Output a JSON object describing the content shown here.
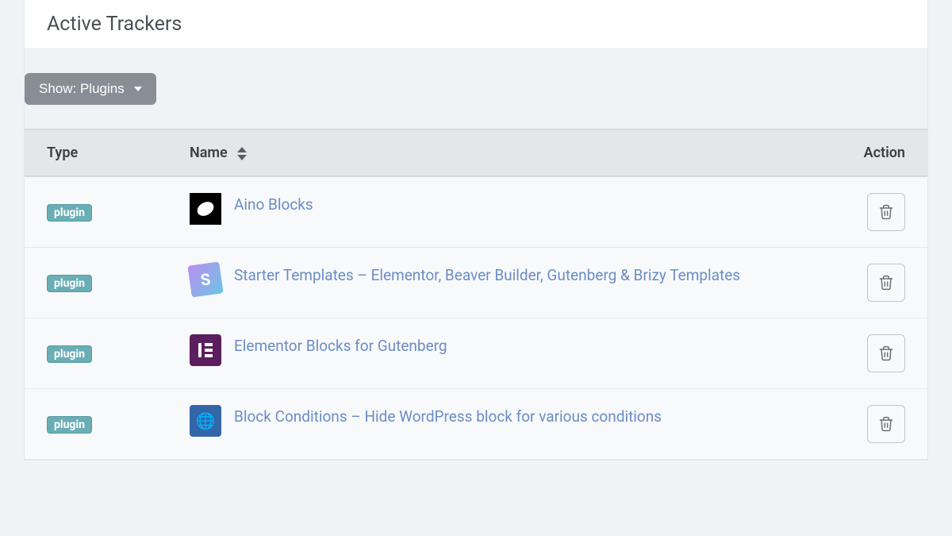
{
  "header": {
    "title": "Active Trackers"
  },
  "filter": {
    "label": "Show: Plugins"
  },
  "table": {
    "columns": {
      "type": "Type",
      "name": "Name",
      "action": "Action"
    },
    "rows": [
      {
        "type_badge": "plugin",
        "name": "Aino Blocks",
        "icon_class": "icon-aino",
        "icon_text": ""
      },
      {
        "type_badge": "plugin",
        "name": "Starter Templates – Elementor, Beaver Builder, Gutenberg & Brizy Templates",
        "icon_class": "icon-starter",
        "icon_text": "S"
      },
      {
        "type_badge": "plugin",
        "name": "Elementor Blocks for Gutenberg",
        "icon_class": "icon-elementor",
        "icon_text": ""
      },
      {
        "type_badge": "plugin",
        "name": "Block Conditions – Hide WordPress block for various conditions",
        "icon_class": "icon-blockconditions",
        "icon_text": "🌐"
      }
    ]
  }
}
